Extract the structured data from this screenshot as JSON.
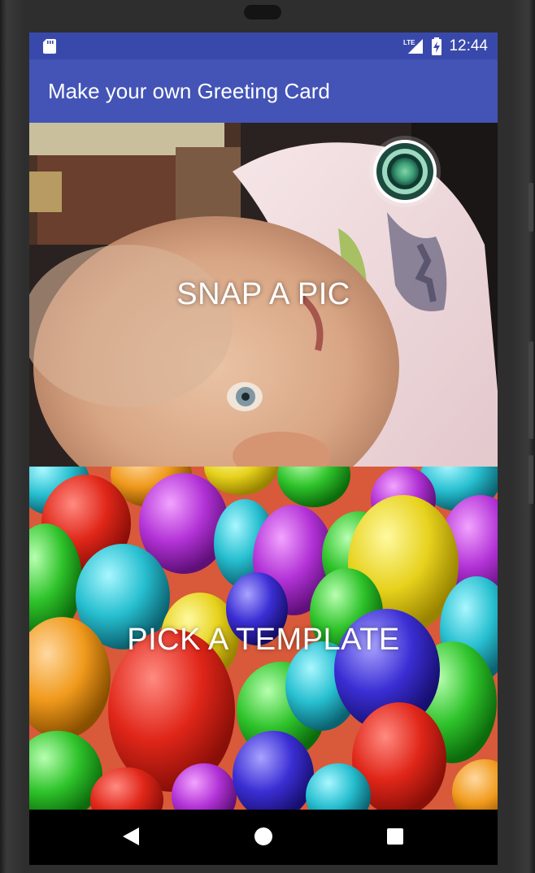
{
  "status_bar": {
    "time": "12:44",
    "network_label": "LTE",
    "icons": [
      "sd-card-icon",
      "lte-signal-icon",
      "battery-charging-icon"
    ]
  },
  "app_bar": {
    "title": "Make your own Greeting Card"
  },
  "options": {
    "snap": {
      "label": "SNAP A PIC"
    },
    "template": {
      "label": "PICK A TEMPLATE"
    }
  },
  "nav_bar": {
    "icons": [
      "back-icon",
      "home-icon",
      "recents-icon"
    ]
  },
  "colors": {
    "status_bar": "#3949ab",
    "app_bar": "#4354b6",
    "nav_bar": "#000000",
    "label_text": "#ffffff"
  }
}
